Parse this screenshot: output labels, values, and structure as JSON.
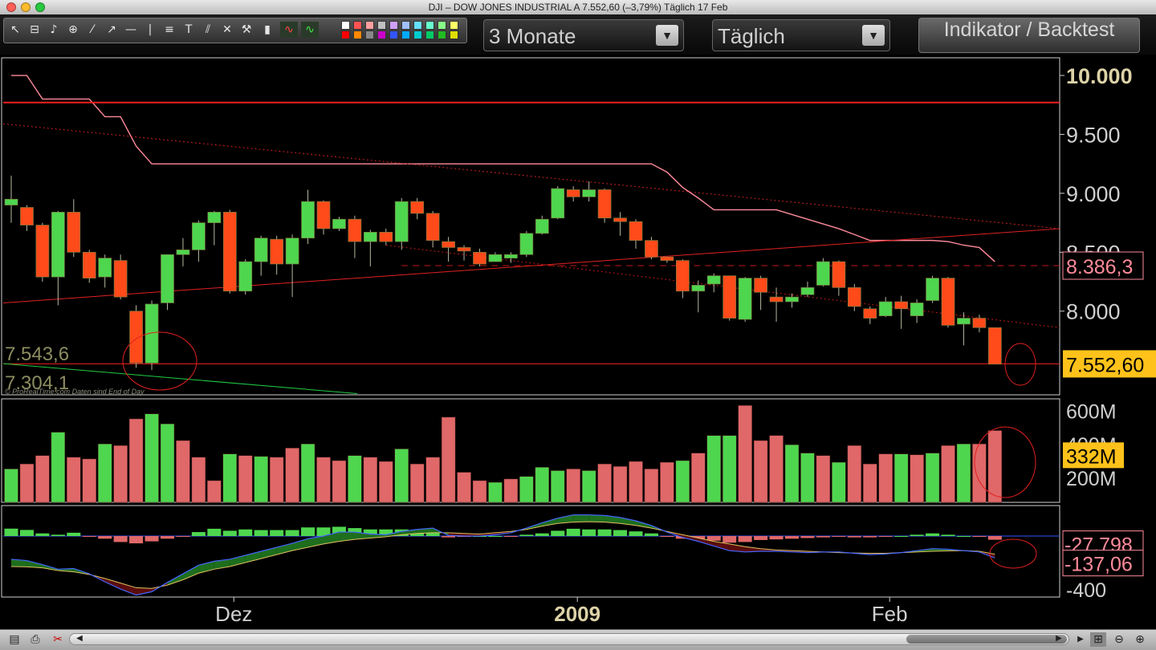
{
  "window": {
    "title": "DJI – DOW JONES INDUSTRIAL A      7.552,60 (–3,79%)      Täglich  17 Feb"
  },
  "toolbar": {
    "tool_icons": [
      "cursor-icon",
      "ruler-icon",
      "alarm-bell-icon",
      "zoom-icon",
      "line-icon",
      "ray-icon",
      "horizontal-line-icon",
      "vertical-line-icon",
      "fibonacci-icon",
      "text-tool-icon",
      "channel-icon",
      "settings-tools-icon",
      "trash-icon",
      "indicator-icon",
      "indicator-alt-icon"
    ],
    "period_label": "3 Monate",
    "interval_label": "Täglich",
    "indicator_button": "Indikator / Backtest",
    "palette": [
      "#ffffff",
      "#ff5252",
      "#ff9ea0",
      "#c0c0c0",
      "#d0a0ff",
      "#a0c0ff",
      "#66e0ff",
      "#66ffcc",
      "#88ff88",
      "#ffff66",
      "#ff0000",
      "#ff8800",
      "#888888",
      "#cc00cc",
      "#3355ff",
      "#00aaff",
      "#00cccc",
      "#00cc66",
      "#22bb22",
      "#dddd00"
    ]
  },
  "chart_data": [
    {
      "type": "candlestick",
      "title": "DJI – DOW JONES INDUSTRIAL A",
      "y_tick_labels": [
        "10.000",
        "9.500",
        "9.000",
        "8.500",
        "8.000"
      ],
      "y_ticks": [
        10000,
        9500,
        9000,
        8500,
        8000
      ],
      "ylim": [
        7290,
        10150
      ],
      "x_tick_labels": [
        "Dez",
        "2009",
        "Feb"
      ],
      "x_tick_index": [
        14,
        36,
        56
      ],
      "last_price_label": "7.552,60",
      "last_price": 7552.6,
      "line_label": "8.386,3",
      "line_value": 8386.3,
      "range_label_high": "7.543,6",
      "range_label_low": "7.304,1",
      "watermark": "© ProRealTime.com  Daten sind End of Day",
      "resistance_level": 9770,
      "support_level": 7552.6,
      "candles": [
        [
          8900,
          8950,
          9150,
          8750
        ],
        [
          8880,
          8730,
          8900,
          8680
        ],
        [
          8730,
          8290,
          8750,
          8250
        ],
        [
          8290,
          8840,
          8850,
          8050
        ],
        [
          8840,
          8500,
          8950,
          8460
        ],
        [
          8500,
          8280,
          8520,
          8240
        ],
        [
          8290,
          8450,
          8480,
          8200
        ],
        [
          8430,
          8120,
          8480,
          8100
        ],
        [
          8000,
          7560,
          8050,
          7520
        ],
        [
          7560,
          8060,
          8090,
          7500
        ],
        [
          8070,
          8480,
          8480,
          8010
        ],
        [
          8480,
          8520,
          8620,
          8380
        ],
        [
          8520,
          8750,
          8770,
          8420
        ],
        [
          8750,
          8840,
          8850,
          8560
        ],
        [
          8840,
          8170,
          8860,
          8150
        ],
        [
          8170,
          8420,
          8440,
          8140
        ],
        [
          8420,
          8620,
          8640,
          8300
        ],
        [
          8610,
          8400,
          8640,
          8310
        ],
        [
          8400,
          8620,
          8650,
          8120
        ],
        [
          8620,
          8930,
          9030,
          8570
        ],
        [
          8930,
          8700,
          8940,
          8650
        ],
        [
          8700,
          8780,
          8800,
          8680
        ],
        [
          8780,
          8590,
          8810,
          8450
        ],
        [
          8590,
          8670,
          8690,
          8380
        ],
        [
          8670,
          8590,
          8700,
          8560
        ],
        [
          8590,
          8930,
          8960,
          8520
        ],
        [
          8930,
          8830,
          8960,
          8780
        ],
        [
          8830,
          8600,
          8850,
          8540
        ],
        [
          8590,
          8540,
          8630,
          8420
        ],
        [
          8540,
          8510,
          8560,
          8430
        ],
        [
          8500,
          8400,
          8530,
          8380
        ],
        [
          8420,
          8480,
          8500,
          8440
        ],
        [
          8450,
          8480,
          8500,
          8410
        ],
        [
          8480,
          8660,
          8680,
          8460
        ],
        [
          8660,
          8780,
          8810,
          8650
        ],
        [
          8790,
          9040,
          9060,
          8780
        ],
        [
          9030,
          8970,
          9060,
          8930
        ],
        [
          8970,
          9030,
          9100,
          8930
        ],
        [
          9030,
          8790,
          9040,
          8750
        ],
        [
          8790,
          8760,
          8840,
          8640
        ],
        [
          8760,
          8600,
          8780,
          8530
        ],
        [
          8600,
          8460,
          8630,
          8440
        ],
        [
          8460,
          8430,
          8460,
          8410
        ],
        [
          8430,
          8170,
          8440,
          8110
        ],
        [
          8170,
          8220,
          8260,
          7990
        ],
        [
          8230,
          8300,
          8320,
          8160
        ],
        [
          8300,
          7940,
          8300,
          7920
        ],
        [
          7930,
          8280,
          8290,
          7910
        ],
        [
          8280,
          8160,
          8300,
          8010
        ],
        [
          8120,
          8080,
          8200,
          7910
        ],
        [
          8080,
          8120,
          8150,
          8030
        ],
        [
          8140,
          8200,
          8250,
          8120
        ],
        [
          8220,
          8420,
          8450,
          8210
        ],
        [
          8420,
          8200,
          8430,
          8130
        ],
        [
          8200,
          8040,
          8230,
          8000
        ],
        [
          8020,
          7940,
          8040,
          7890
        ],
        [
          7960,
          8080,
          8120,
          7950
        ],
        [
          8080,
          8020,
          8130,
          7850
        ],
        [
          7960,
          8070,
          8100,
          7900
        ],
        [
          8090,
          8280,
          8300,
          8070
        ],
        [
          8280,
          7880,
          8290,
          7860
        ],
        [
          7890,
          7940,
          7990,
          7710
        ],
        [
          7940,
          7860,
          7970,
          7820
        ],
        [
          7860,
          7550,
          7860,
          7550
        ]
      ],
      "series": [
        {
          "name": "",
          "color": "#ff8a9a",
          "values": [
            10000,
            10000,
            9800,
            9800,
            9800,
            9800,
            9650,
            9650,
            9400,
            9250,
            9250,
            9250,
            9250,
            9250,
            9250,
            9250,
            9250,
            9250,
            9250,
            9250,
            9250,
            9250,
            9250,
            9250,
            9250,
            9250,
            9250,
            9250,
            9250,
            9250,
            9250,
            9250,
            9250,
            9250,
            9250,
            9250,
            9250,
            9250,
            9250,
            9250,
            9250,
            9250,
            9180,
            9050,
            8960,
            8860,
            8860,
            8860,
            8860,
            8860,
            8820,
            8780,
            8740,
            8700,
            8650,
            8600,
            8600,
            8600,
            8600,
            8600,
            8590,
            8560,
            8540,
            8420
          ]
        },
        {
          "name": "",
          "color": "#ee2222",
          "values": [
            8070,
            8260,
            8450,
            8640,
            8700
          ]
        },
        {
          "name": "",
          "color": "#ee2222",
          "values": [
            9590,
            8840,
            8730,
            8250,
            8290,
            8320,
            7970,
            7860
          ]
        },
        {
          "name": "",
          "color": "#22cc44",
          "values": [
            7560,
            7450
          ]
        }
      ]
    },
    {
      "type": "bar",
      "title": "Volume",
      "y_tick_labels": [
        "600M",
        "400M",
        "200M"
      ],
      "y_ticks": [
        600,
        400,
        200
      ],
      "ylim": [
        50,
        670
      ],
      "unit": "M",
      "last_value_label": "332M",
      "last_value": 332,
      "bull": [
        true,
        false,
        false,
        true,
        false,
        false,
        true,
        false,
        false,
        true,
        true,
        false,
        false,
        false,
        true,
        false,
        true,
        false,
        false,
        true,
        false,
        false,
        true,
        false,
        false,
        true,
        false,
        false,
        false,
        false,
        false,
        true,
        false,
        true,
        true,
        true,
        false,
        true,
        false,
        false,
        false,
        false,
        false,
        true,
        false,
        true,
        true,
        false,
        false,
        false,
        true,
        true,
        false,
        true,
        false,
        false,
        false,
        true,
        false,
        true,
        false,
        true,
        false,
        false
      ],
      "values": [
        250,
        280,
        330,
        470,
        320,
        310,
        400,
        390,
        550,
        580,
        520,
        420,
        320,
        180,
        340,
        330,
        325,
        320,
        375,
        400,
        320,
        300,
        330,
        320,
        295,
        370,
        280,
        320,
        560,
        230,
        180,
        170,
        190,
        205,
        260,
        240,
        250,
        240,
        280,
        265,
        295,
        250,
        290,
        300,
        345,
        450,
        450,
        630,
        420,
        450,
        395,
        345,
        330,
        290,
        390,
        280,
        340,
        340,
        335,
        345,
        390,
        400,
        400,
        480
      ]
    },
    {
      "type": "area",
      "title": "MACD",
      "y_tick_labels": [
        "-400"
      ],
      "y_ticks": [
        -400
      ],
      "ylim": [
        -460,
        230
      ],
      "label_1": "-27,798",
      "value_1": -27.798,
      "label_2": "-137,06",
      "value_2": -137.06,
      "histogram": [
        56,
        46,
        20,
        10,
        25,
        -5,
        -20,
        -45,
        -55,
        -40,
        -20,
        -5,
        30,
        55,
        40,
        50,
        45,
        45,
        45,
        65,
        65,
        70,
        60,
        50,
        50,
        50,
        30,
        25,
        -10,
        -5,
        0,
        0,
        -5,
        10,
        20,
        40,
        55,
        50,
        50,
        45,
        35,
        20,
        -5,
        -20,
        -25,
        -35,
        -50,
        -45,
        -30,
        -25,
        -20,
        -15,
        -10,
        -5,
        -10,
        -10,
        -5,
        0,
        10,
        20,
        10,
        0,
        -5,
        -28
      ],
      "signal": [
        -230,
        -232,
        -240,
        -260,
        -270,
        -290,
        -320,
        -355,
        -390,
        -395,
        -370,
        -330,
        -280,
        -250,
        -230,
        -200,
        -170,
        -140,
        -110,
        -85,
        -60,
        -40,
        -25,
        -15,
        -5,
        10,
        20,
        25,
        25,
        20,
        15,
        25,
        35,
        50,
        75,
        95,
        105,
        108,
        105,
        95,
        80,
        60,
        35,
        10,
        -15,
        -40,
        -60,
        -80,
        -95,
        -105,
        -110,
        -115,
        -120,
        -125,
        -128,
        -130,
        -130,
        -125,
        -120,
        -115,
        -112,
        -110,
        -115,
        -137
      ],
      "macd": [
        -175,
        -185,
        -215,
        -250,
        -245,
        -285,
        -345,
        -400,
        -445,
        -420,
        -350,
        -285,
        -220,
        -190,
        -175,
        -145,
        -115,
        -85,
        -55,
        -20,
        0,
        30,
        30,
        15,
        10,
        35,
        50,
        60,
        5,
        0,
        0,
        10,
        25,
        60,
        100,
        135,
        160,
        160,
        155,
        140,
        115,
        80,
        30,
        -10,
        -40,
        -75,
        -110,
        -120,
        -115,
        -115,
        -120,
        -125,
        -120,
        -120,
        -130,
        -140,
        -135,
        -125,
        -110,
        -95,
        -100,
        -110,
        -120,
        -165
      ]
    }
  ]
}
